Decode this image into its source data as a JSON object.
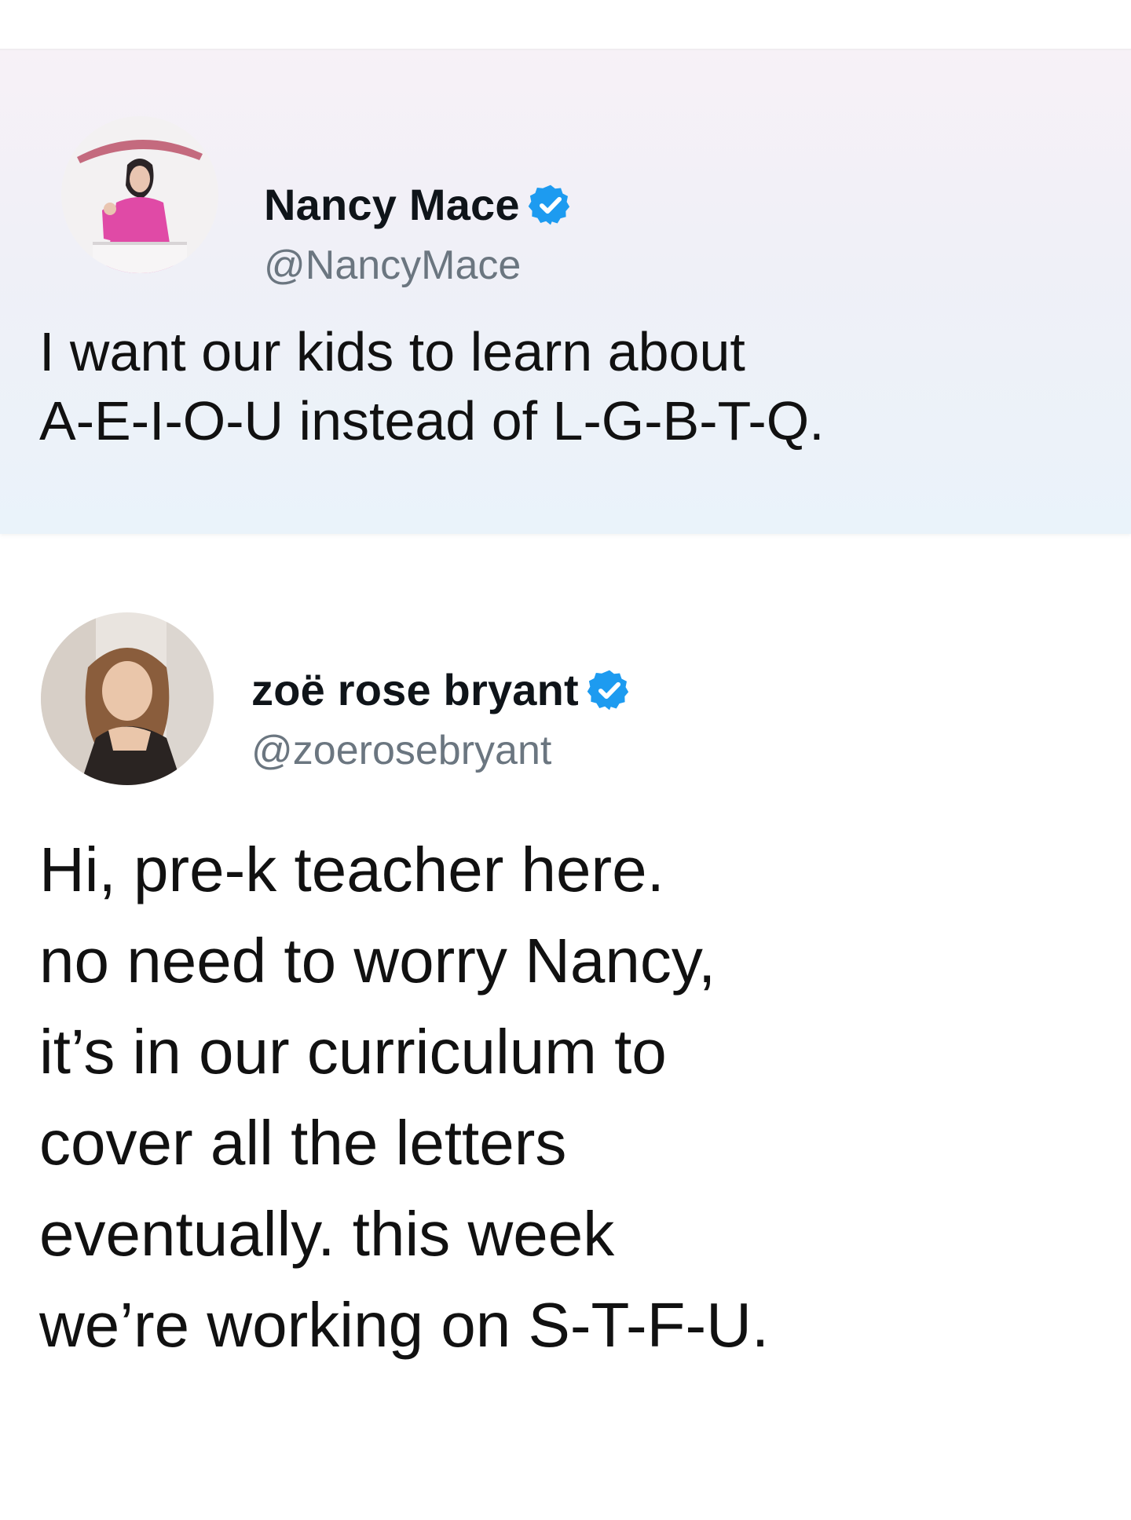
{
  "tweets": [
    {
      "display_name": "Nancy Mace",
      "handle": "@NancyMace",
      "verified_icon": "verified-badge-icon",
      "body_lines": "I want our kids to learn about\nA-E-I-O-U instead of L-G-B-T-Q."
    },
    {
      "display_name": "zoë rose bryant",
      "handle": "@zoerosebryant",
      "verified_icon": "verified-badge-icon",
      "body_lines": "Hi, pre-k teacher here.\nno need to worry Nancy,\nit’s in our curriculum to\ncover all the letters\neventually. this week\nwe’re working on S-T-F-U."
    }
  ],
  "colors": {
    "verified_blue": "#1d9bf0",
    "handle_gray": "#6b7680",
    "text": "#111111"
  }
}
